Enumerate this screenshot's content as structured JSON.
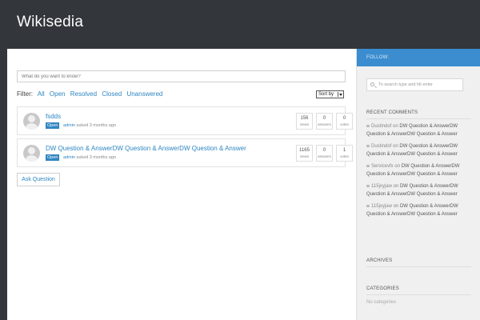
{
  "site": {
    "title": "Wikisedia"
  },
  "search": {
    "placeholder": "What do you want to know?"
  },
  "filter": {
    "label": "Filter:",
    "options": [
      "All",
      "Open",
      "Resolved",
      "Closed",
      "Unanswered"
    ],
    "sort_label": "Sort by"
  },
  "questions": [
    {
      "title": "fsdds",
      "status": "Open",
      "author": "admin",
      "meta": "asked 3 months ago",
      "views": "156",
      "views_label": "views",
      "answers": "0",
      "answers_label": "answers",
      "votes": "0",
      "votes_label": "votes"
    },
    {
      "title": "DW Question & AnswerDW Question & AnswerDW Question & Answer",
      "status": "Open",
      "author": "admin",
      "meta": "asked 3 months ago",
      "views": "1165",
      "views_label": "views",
      "answers": "0",
      "answers_label": "answers",
      "votes": "1",
      "votes_label": "votes"
    }
  ],
  "ask_button": "Ask Question",
  "sidebar": {
    "follow_label": "FOLLOW:",
    "search_placeholder": "To search type and hit enter",
    "recent_comments_title": "RECENT COMMENTS",
    "recent_comments": [
      {
        "author": "Dustindof",
        "on": "on",
        "link": "DW Question & AnswerDW Question & AnswerDW Question & Answer"
      },
      {
        "author": "Dustindof",
        "on": "on",
        "link": "DW Question & AnswerDW Question & AnswerDW Question & Answer"
      },
      {
        "author": "Servicevfx",
        "on": "on",
        "link": "DW Question & AnswerDW Question & AnswerDW Question & Answer"
      },
      {
        "author": "115jxyjaw",
        "on": "on",
        "link": "DW Question & AnswerDW Question & AnswerDW Question & Answer"
      },
      {
        "author": "115jxyjaw",
        "on": "on",
        "link": "DW Question & AnswerDW Question & AnswerDW Question & Answer"
      }
    ],
    "archives_title": "ARCHIVES",
    "categories_title": "CATEGORIES",
    "no_categories": "No categories"
  },
  "colors": {
    "header": "#33363b",
    "accent": "#2f86c1",
    "follow_bar": "#3b8dd0"
  }
}
